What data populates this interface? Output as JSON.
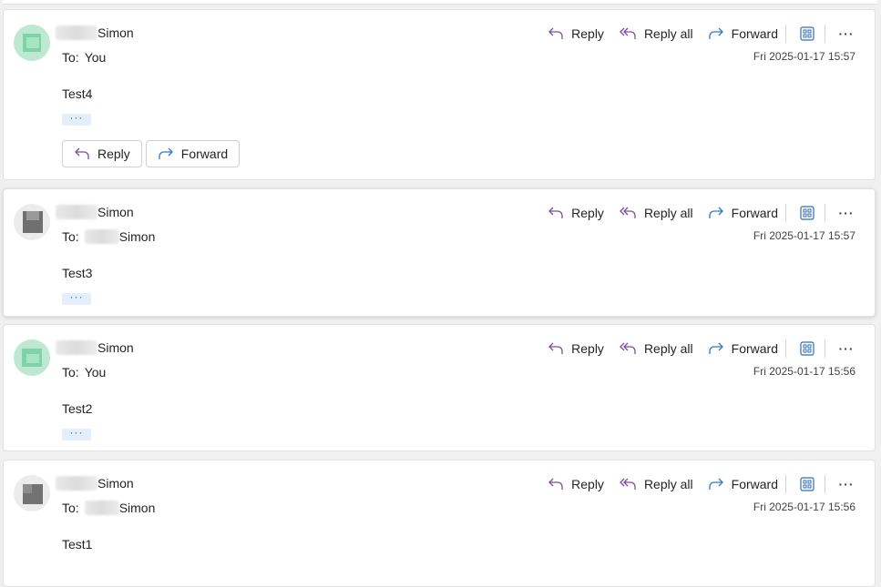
{
  "colors": {
    "reply_icon": "#7a4ea0",
    "forward_icon": "#2f7bc5",
    "apps_icon": "#2f6db5"
  },
  "toolbar": {
    "reply": "Reply",
    "reply_all": "Reply all",
    "forward": "Forward",
    "more": "···"
  },
  "ellipsis": "···",
  "messages": [
    {
      "sender": "Simon",
      "to_label": "To:",
      "to": "You",
      "date": "Fri 2025-01-17 15:57",
      "body": "Test4",
      "reply_button": "Reply",
      "forward_button": "Forward"
    },
    {
      "sender": "Simon",
      "to_label": "To:",
      "to": "Simon",
      "date": "Fri 2025-01-17 15:57",
      "body": "Test3"
    },
    {
      "sender": "Simon",
      "to_label": "To:",
      "to": "You",
      "date": "Fri 2025-01-17 15:56",
      "body": "Test2"
    },
    {
      "sender": "Simon",
      "to_label": "To:",
      "to": "Simon",
      "date": "Fri 2025-01-17 15:56",
      "body": "Test1"
    }
  ]
}
